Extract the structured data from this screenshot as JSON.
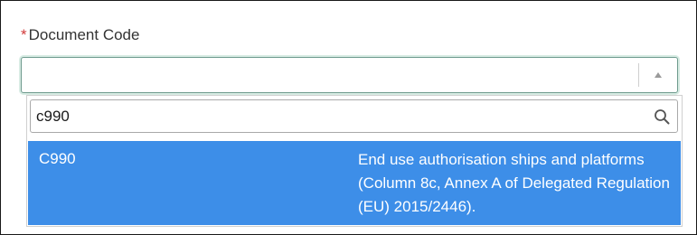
{
  "field": {
    "required_marker": "*",
    "label": "Document Code",
    "value": ""
  },
  "dropdown": {
    "search_value": "c990",
    "options": [
      {
        "code": "C990",
        "description": "End use authorisation ships and platforms (Column 8c, Annex A of Delegated Regulation (EU) 2015/2446).",
        "highlighted": true
      }
    ]
  },
  "icons": {
    "toggle": "chevron-up-icon",
    "search": "search-icon"
  },
  "colors": {
    "required": "#d23a3a",
    "highlight": "#3d8ee8",
    "focus_border": "#6f9b8e"
  }
}
